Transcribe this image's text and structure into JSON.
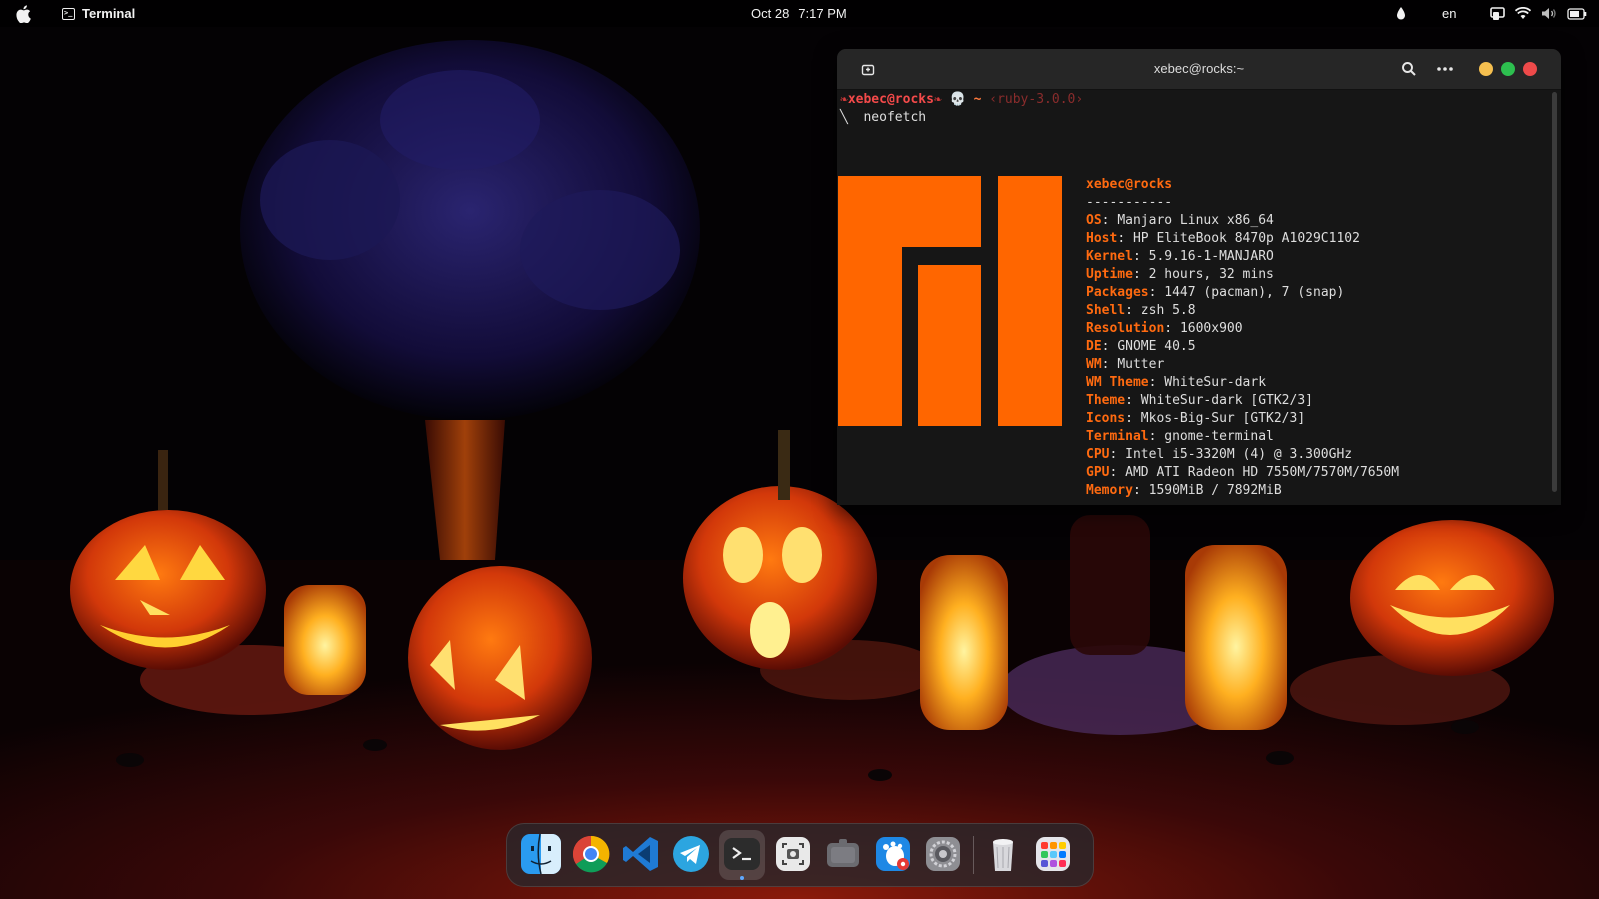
{
  "topbar": {
    "apple_icon": "apple-icon",
    "app_name": "Terminal",
    "date": "Oct 28",
    "time": "7:17 PM",
    "language": "en",
    "icons": [
      "notification-drop-icon",
      "screen-mirror-icon",
      "wifi-icon",
      "volume-icon",
      "battery-icon"
    ]
  },
  "terminal": {
    "title": "xebec@rocks:~",
    "prompt": {
      "user": "xebec@rocks",
      "skull": "💀",
      "dir": "~",
      "ruby": "‹ruby-3.0.0›"
    },
    "command": "neofetch",
    "info_title": "xebec@rocks",
    "separator": "-----------",
    "fields": [
      {
        "key": "OS",
        "value": "Manjaro Linux x86_64"
      },
      {
        "key": "Host",
        "value": "HP EliteBook 8470p A1029C1102"
      },
      {
        "key": "Kernel",
        "value": "5.9.16-1-MANJARO"
      },
      {
        "key": "Uptime",
        "value": "2 hours, 32 mins"
      },
      {
        "key": "Packages",
        "value": "1447 (pacman), 7 (snap)"
      },
      {
        "key": "Shell",
        "value": "zsh 5.8"
      },
      {
        "key": "Resolution",
        "value": "1600x900"
      },
      {
        "key": "DE",
        "value": "GNOME 40.5"
      },
      {
        "key": "WM",
        "value": "Mutter"
      },
      {
        "key": "WM Theme",
        "value": "WhiteSur-dark"
      },
      {
        "key": "Theme",
        "value": "WhiteSur-dark [GTK2/3]"
      },
      {
        "key": "Icons",
        "value": "Mkos-Big-Sur [GTK2/3]"
      },
      {
        "key": "Terminal",
        "value": "gnome-terminal"
      },
      {
        "key": "CPU",
        "value": "Intel i5-3320M (4) @ 3.300GHz"
      },
      {
        "key": "GPU",
        "value": "AMD ATI Radeon HD 7550M/7570M/7650M"
      },
      {
        "key": "Memory",
        "value": "1590MiB / 7892MiB"
      }
    ],
    "palette_top": [
      "#141424",
      "#e01818",
      "#1496b4",
      "#c8c814",
      "#f01490",
      "#7814e6",
      "#14c8c8",
      "#f0e6d2"
    ],
    "palette_bottom": [
      "#4a4a4a",
      "#e04040",
      "#ff6a10",
      "#ffff10",
      "#f0c814",
      "#a050f0",
      "#10f0f0",
      "#ffffff"
    ],
    "logo_color": "#ff6600"
  },
  "dock": {
    "apps": [
      {
        "name": "finder",
        "icon": "finder-icon"
      },
      {
        "name": "chrome",
        "icon": "chrome-icon"
      },
      {
        "name": "vscode",
        "icon": "vscode-icon"
      },
      {
        "name": "telegram",
        "icon": "telegram-icon"
      },
      {
        "name": "terminal",
        "icon": "terminal-icon",
        "active": true
      },
      {
        "name": "screenshot",
        "icon": "screenshot-icon"
      },
      {
        "name": "extensions",
        "icon": "extensions-icon"
      },
      {
        "name": "gnome-tweaks",
        "icon": "gnome-tweaks-icon"
      },
      {
        "name": "settings",
        "icon": "settings-icon"
      },
      {
        "name": "trash",
        "icon": "trash-icon"
      },
      {
        "name": "app-grid",
        "icon": "app-grid-icon"
      }
    ]
  }
}
